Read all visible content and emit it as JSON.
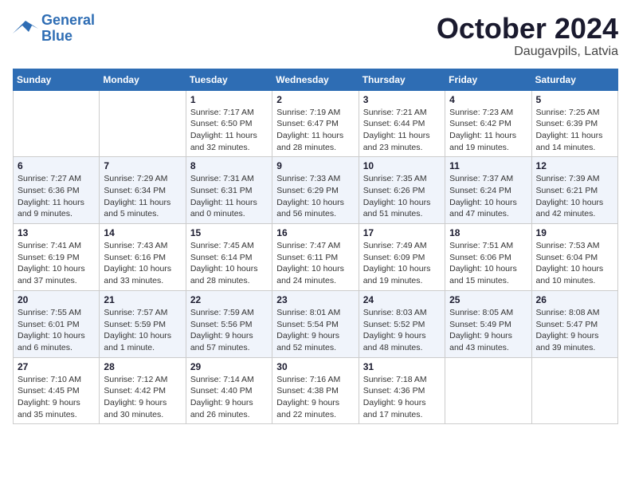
{
  "logo": {
    "line1": "General",
    "line2": "Blue"
  },
  "title": "October 2024",
  "location": "Daugavpils, Latvia",
  "days_of_week": [
    "Sunday",
    "Monday",
    "Tuesday",
    "Wednesday",
    "Thursday",
    "Friday",
    "Saturday"
  ],
  "weeks": [
    [
      {
        "day": "",
        "info": ""
      },
      {
        "day": "",
        "info": ""
      },
      {
        "day": "1",
        "info": "Sunrise: 7:17 AM\nSunset: 6:50 PM\nDaylight: 11 hours\nand 32 minutes."
      },
      {
        "day": "2",
        "info": "Sunrise: 7:19 AM\nSunset: 6:47 PM\nDaylight: 11 hours\nand 28 minutes."
      },
      {
        "day": "3",
        "info": "Sunrise: 7:21 AM\nSunset: 6:44 PM\nDaylight: 11 hours\nand 23 minutes."
      },
      {
        "day": "4",
        "info": "Sunrise: 7:23 AM\nSunset: 6:42 PM\nDaylight: 11 hours\nand 19 minutes."
      },
      {
        "day": "5",
        "info": "Sunrise: 7:25 AM\nSunset: 6:39 PM\nDaylight: 11 hours\nand 14 minutes."
      }
    ],
    [
      {
        "day": "6",
        "info": "Sunrise: 7:27 AM\nSunset: 6:36 PM\nDaylight: 11 hours\nand 9 minutes."
      },
      {
        "day": "7",
        "info": "Sunrise: 7:29 AM\nSunset: 6:34 PM\nDaylight: 11 hours\nand 5 minutes."
      },
      {
        "day": "8",
        "info": "Sunrise: 7:31 AM\nSunset: 6:31 PM\nDaylight: 11 hours\nand 0 minutes."
      },
      {
        "day": "9",
        "info": "Sunrise: 7:33 AM\nSunset: 6:29 PM\nDaylight: 10 hours\nand 56 minutes."
      },
      {
        "day": "10",
        "info": "Sunrise: 7:35 AM\nSunset: 6:26 PM\nDaylight: 10 hours\nand 51 minutes."
      },
      {
        "day": "11",
        "info": "Sunrise: 7:37 AM\nSunset: 6:24 PM\nDaylight: 10 hours\nand 47 minutes."
      },
      {
        "day": "12",
        "info": "Sunrise: 7:39 AM\nSunset: 6:21 PM\nDaylight: 10 hours\nand 42 minutes."
      }
    ],
    [
      {
        "day": "13",
        "info": "Sunrise: 7:41 AM\nSunset: 6:19 PM\nDaylight: 10 hours\nand 37 minutes."
      },
      {
        "day": "14",
        "info": "Sunrise: 7:43 AM\nSunset: 6:16 PM\nDaylight: 10 hours\nand 33 minutes."
      },
      {
        "day": "15",
        "info": "Sunrise: 7:45 AM\nSunset: 6:14 PM\nDaylight: 10 hours\nand 28 minutes."
      },
      {
        "day": "16",
        "info": "Sunrise: 7:47 AM\nSunset: 6:11 PM\nDaylight: 10 hours\nand 24 minutes."
      },
      {
        "day": "17",
        "info": "Sunrise: 7:49 AM\nSunset: 6:09 PM\nDaylight: 10 hours\nand 19 minutes."
      },
      {
        "day": "18",
        "info": "Sunrise: 7:51 AM\nSunset: 6:06 PM\nDaylight: 10 hours\nand 15 minutes."
      },
      {
        "day": "19",
        "info": "Sunrise: 7:53 AM\nSunset: 6:04 PM\nDaylight: 10 hours\nand 10 minutes."
      }
    ],
    [
      {
        "day": "20",
        "info": "Sunrise: 7:55 AM\nSunset: 6:01 PM\nDaylight: 10 hours\nand 6 minutes."
      },
      {
        "day": "21",
        "info": "Sunrise: 7:57 AM\nSunset: 5:59 PM\nDaylight: 10 hours\nand 1 minute."
      },
      {
        "day": "22",
        "info": "Sunrise: 7:59 AM\nSunset: 5:56 PM\nDaylight: 9 hours\nand 57 minutes."
      },
      {
        "day": "23",
        "info": "Sunrise: 8:01 AM\nSunset: 5:54 PM\nDaylight: 9 hours\nand 52 minutes."
      },
      {
        "day": "24",
        "info": "Sunrise: 8:03 AM\nSunset: 5:52 PM\nDaylight: 9 hours\nand 48 minutes."
      },
      {
        "day": "25",
        "info": "Sunrise: 8:05 AM\nSunset: 5:49 PM\nDaylight: 9 hours\nand 43 minutes."
      },
      {
        "day": "26",
        "info": "Sunrise: 8:08 AM\nSunset: 5:47 PM\nDaylight: 9 hours\nand 39 minutes."
      }
    ],
    [
      {
        "day": "27",
        "info": "Sunrise: 7:10 AM\nSunset: 4:45 PM\nDaylight: 9 hours\nand 35 minutes."
      },
      {
        "day": "28",
        "info": "Sunrise: 7:12 AM\nSunset: 4:42 PM\nDaylight: 9 hours\nand 30 minutes."
      },
      {
        "day": "29",
        "info": "Sunrise: 7:14 AM\nSunset: 4:40 PM\nDaylight: 9 hours\nand 26 minutes."
      },
      {
        "day": "30",
        "info": "Sunrise: 7:16 AM\nSunset: 4:38 PM\nDaylight: 9 hours\nand 22 minutes."
      },
      {
        "day": "31",
        "info": "Sunrise: 7:18 AM\nSunset: 4:36 PM\nDaylight: 9 hours\nand 17 minutes."
      },
      {
        "day": "",
        "info": ""
      },
      {
        "day": "",
        "info": ""
      }
    ]
  ]
}
